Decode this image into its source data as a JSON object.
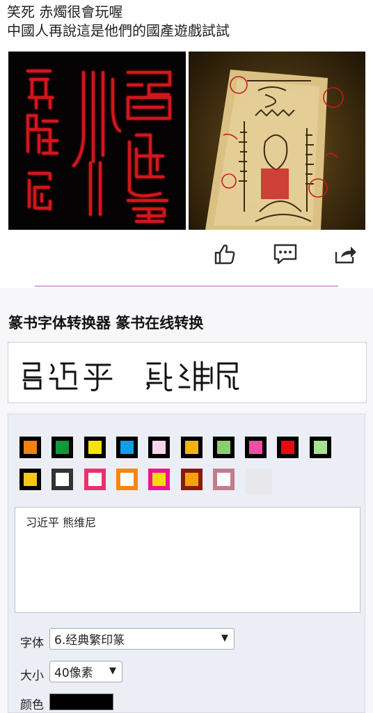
{
  "post": {
    "line1": "笑死 赤燭很會玩喔",
    "line2": "中國人再說這是他們的國產遊戲試試"
  },
  "images": {
    "left": {
      "description_icon": "red-neon-seal-glyphs"
    },
    "right": {
      "description_icon": "talisman-paper-with-red-seal"
    }
  },
  "actions": {
    "like_icon": "thumbs-up-icon",
    "comment_icon": "comment-icon",
    "share_icon": "share-icon"
  },
  "tool": {
    "title": "篆书字体转换器 篆书在线转换",
    "input_text": "习近平 熊维尼",
    "font_label": "字体",
    "font_value": "6.经典繁印篆",
    "size_label": "大小",
    "size_value": "40像素",
    "color_label": "颜色",
    "color_value": "#000000",
    "swatches_row1": [
      "#f0830f",
      "#12973d",
      "#f5e404",
      "#0f9fe5",
      "#f7d4ef",
      "#f2b40f",
      "#8dcd72",
      "#ee4fa6",
      "#e50b12",
      "#a7e38f"
    ],
    "swatches_row2": [
      "#f4c71c",
      "#ffffff",
      "#ffffff",
      "#ffffff",
      "#f7d90b",
      "#f7a30e",
      "#ffffff"
    ],
    "swatches_row2_borders": [
      "#000000",
      "#333333",
      "#e8316e",
      "#f5860f",
      "#e9168c",
      "#8b1a0e",
      "#c17d8c"
    ]
  }
}
